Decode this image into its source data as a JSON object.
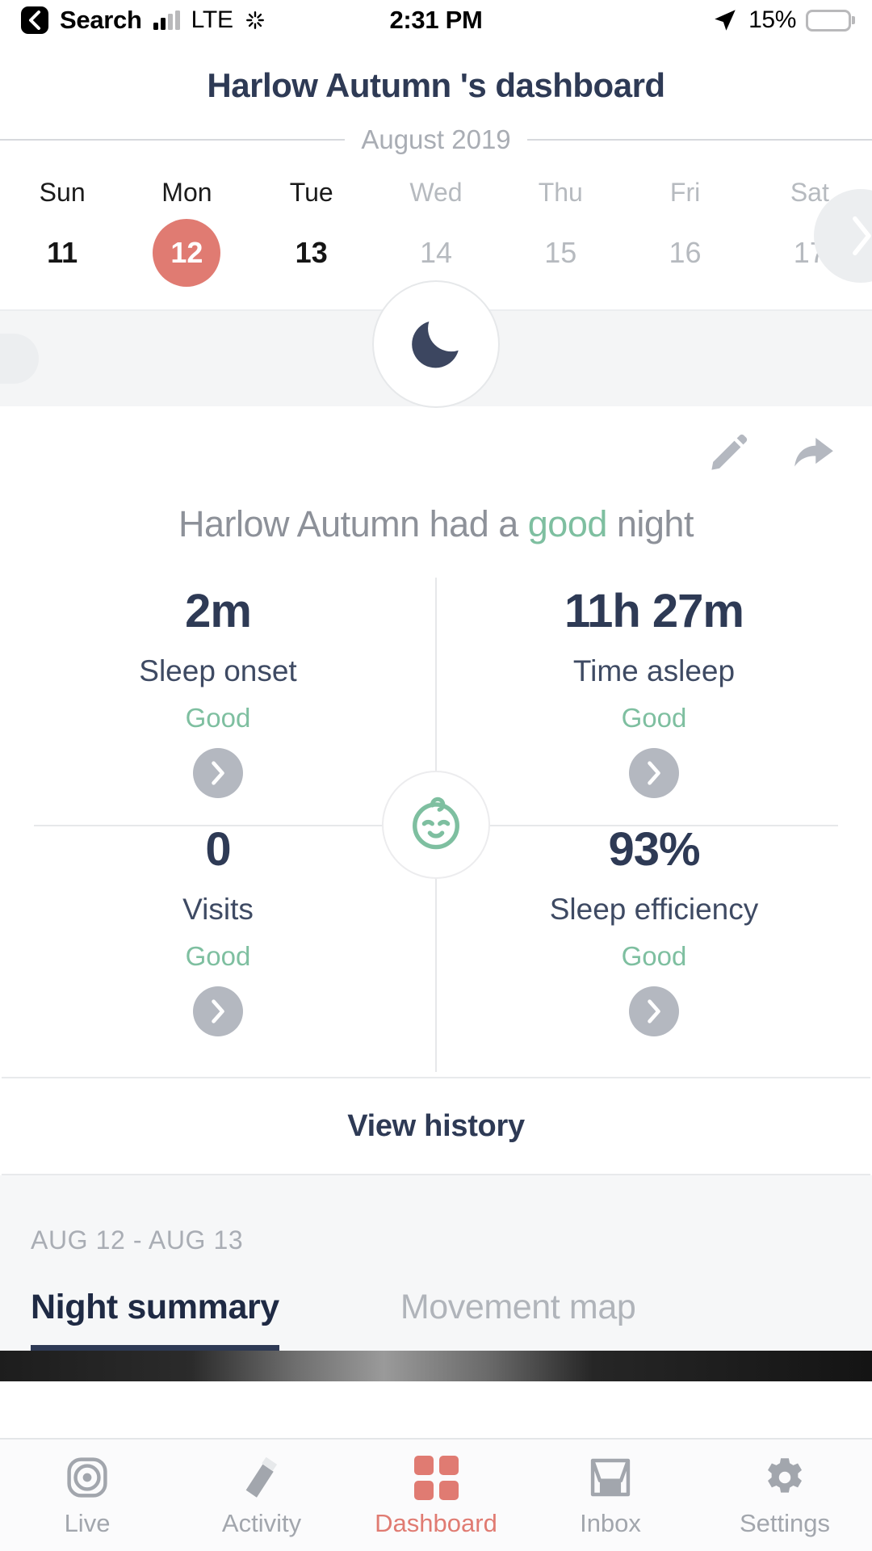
{
  "statusbar": {
    "back_label": "Search",
    "carrier": "LTE",
    "time": "2:31 PM",
    "battery_percent": "15%"
  },
  "header": {
    "title": "Harlow Autumn 's dashboard",
    "month": "August 2019"
  },
  "week": {
    "days": [
      {
        "dow": "Sun",
        "num": "11",
        "state": "past"
      },
      {
        "dow": "Mon",
        "num": "12",
        "state": "selected"
      },
      {
        "dow": "Tue",
        "num": "13",
        "state": "past"
      },
      {
        "dow": "Wed",
        "num": "14",
        "state": "future"
      },
      {
        "dow": "Thu",
        "num": "15",
        "state": "future"
      },
      {
        "dow": "Fri",
        "num": "16",
        "state": "future"
      },
      {
        "dow": "Sat",
        "num": "17",
        "state": "future"
      }
    ],
    "next_week_icon": "chevron-right-icon"
  },
  "summary": {
    "status_icon": "moon-icon",
    "edit_icon": "pencil-icon",
    "share_icon": "share-arrow-icon",
    "headline_prefix": "Harlow Autumn  had a ",
    "headline_quality": "good",
    "headline_suffix": " night",
    "center_icon": "baby-face-icon"
  },
  "metrics": [
    {
      "value": "2m",
      "label": "Sleep onset",
      "quality": "Good"
    },
    {
      "value": "11h 27m",
      "label": "Time asleep",
      "quality": "Good"
    },
    {
      "value": "0",
      "label": "Visits",
      "quality": "Good"
    },
    {
      "value": "93%",
      "label": "Sleep efficiency",
      "quality": "Good"
    }
  ],
  "history_button": "View history",
  "panel": {
    "range": "AUG 12 - AUG 13",
    "tabs": [
      {
        "label": "Night summary",
        "active": true
      },
      {
        "label": "Movement map",
        "active": false
      }
    ]
  },
  "tabbar": [
    {
      "label": "Live",
      "icon": "target-icon",
      "active": false
    },
    {
      "label": "Activity",
      "icon": "bottle-icon",
      "active": false
    },
    {
      "label": "Dashboard",
      "icon": "grid-icon",
      "active": true
    },
    {
      "label": "Inbox",
      "icon": "inbox-icon",
      "active": false
    },
    {
      "label": "Settings",
      "icon": "gear-icon",
      "active": false
    }
  ],
  "colors": {
    "accent": "#e07b72",
    "navy": "#2e3a55",
    "green": "#7ebfa0",
    "grey": "#a9adb4"
  }
}
